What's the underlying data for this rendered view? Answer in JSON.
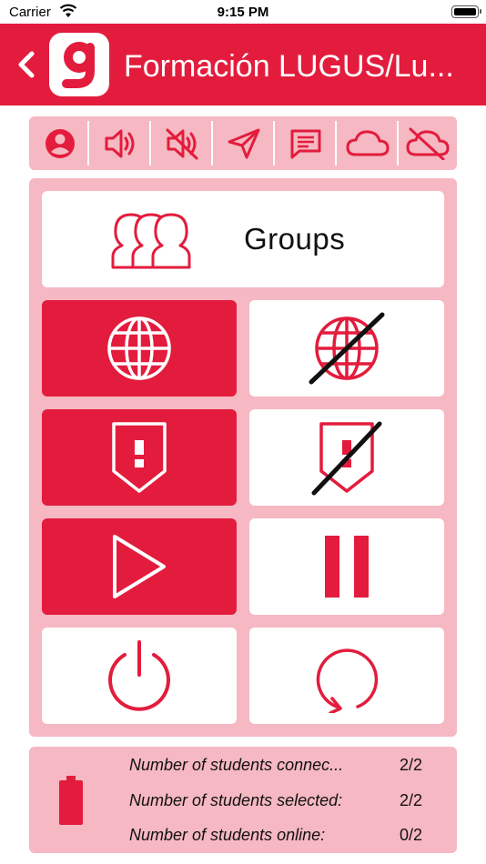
{
  "status_bar": {
    "carrier": "Carrier",
    "time": "9:15 PM"
  },
  "header": {
    "title": "Formación LUGUS/Lu...",
    "logo_letter": "g",
    "back_icon": "chevron-left-icon"
  },
  "toolbar": {
    "buttons": [
      {
        "name": "user-profile",
        "icon": "user-circle-icon"
      },
      {
        "name": "sound-on",
        "icon": "speaker-icon"
      },
      {
        "name": "sound-off",
        "icon": "speaker-muted-icon"
      },
      {
        "name": "send-message",
        "icon": "paper-plane-icon"
      },
      {
        "name": "chat",
        "icon": "chat-bubble-icon"
      },
      {
        "name": "cloud-on",
        "icon": "cloud-icon"
      },
      {
        "name": "cloud-off",
        "icon": "cloud-off-icon"
      }
    ]
  },
  "groups": {
    "label": "Groups",
    "icon": "users-group-icon"
  },
  "tiles": [
    {
      "name": "internet-enable",
      "icon": "globe-icon",
      "style": "red"
    },
    {
      "name": "internet-disable",
      "icon": "globe-off-icon",
      "style": "white"
    },
    {
      "name": "alert-enable",
      "icon": "alert-shield-icon",
      "style": "red"
    },
    {
      "name": "alert-disable",
      "icon": "alert-shield-off-icon",
      "style": "white"
    },
    {
      "name": "play",
      "icon": "play-icon",
      "style": "red"
    },
    {
      "name": "pause",
      "icon": "pause-icon",
      "style": "white"
    },
    {
      "name": "power",
      "icon": "power-icon",
      "style": "white"
    },
    {
      "name": "restart",
      "icon": "restart-icon",
      "style": "white"
    }
  ],
  "info": {
    "battery_icon": "battery-icon",
    "rows": [
      {
        "label": "Number of students connec...",
        "value": "2/2"
      },
      {
        "label": "Number of students selected:",
        "value": "2/2"
      },
      {
        "label": "Number of students online:",
        "value": "0/2"
      }
    ]
  },
  "colors": {
    "brand_red": "#e31c3d",
    "panel_pink": "#f6b8c2",
    "white": "#ffffff"
  }
}
